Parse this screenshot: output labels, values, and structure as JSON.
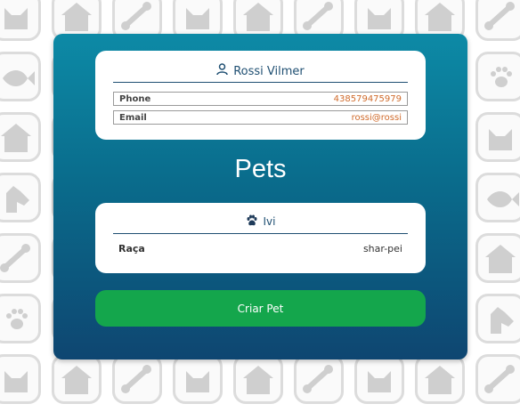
{
  "owner": {
    "name": "Rossi Vilmer",
    "icon": "user-icon",
    "fields": [
      {
        "label": "Phone",
        "value": "438579475979"
      },
      {
        "label": "Email",
        "value": "rossi@rossi"
      }
    ]
  },
  "pets_section": {
    "title": "Pets",
    "pets": [
      {
        "name": "Ivi",
        "icon": "paw-icon",
        "attributes": [
          {
            "label": "Raça",
            "value": "shar-pei"
          }
        ]
      }
    ]
  },
  "actions": {
    "create_pet_label": "Criar Pet"
  },
  "colors": {
    "panel_top": "#0d8aa6",
    "panel_bottom": "#0e4671",
    "accent_value": "#d06b2c",
    "button": "#14a64c",
    "title_text": "#1f4f72"
  },
  "background": {
    "pattern": "pet-doodle-tiles"
  }
}
